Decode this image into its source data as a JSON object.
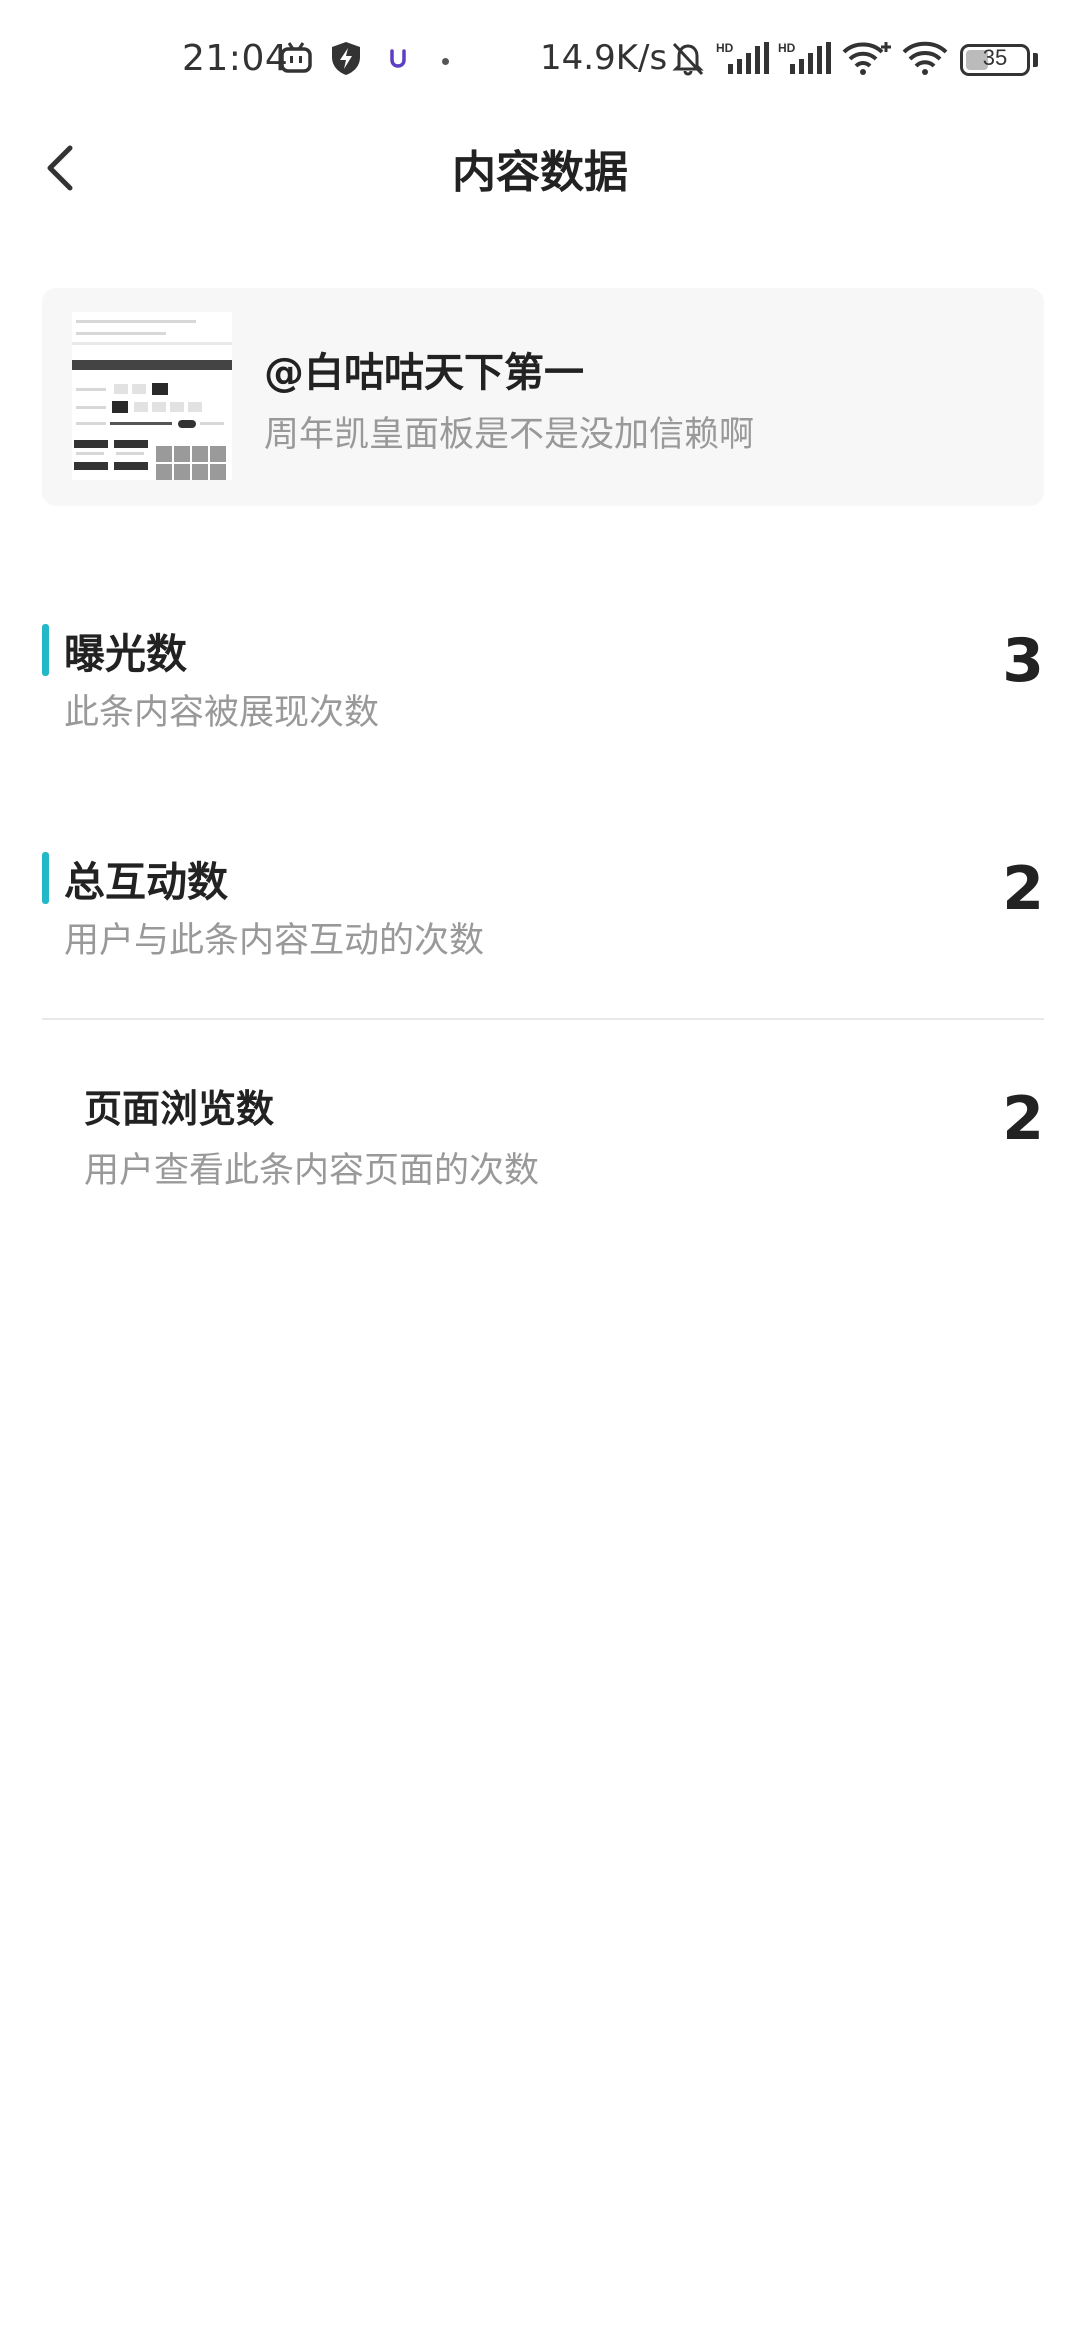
{
  "status_bar": {
    "time": "21:04",
    "net_speed": "14.9K/s",
    "battery": "35",
    "icons": [
      "tv-icon",
      "shield-bolt-icon",
      "app-u-icon",
      "dot-icon",
      "bell-off-icon",
      "hd-signal-icon",
      "hd-signal-icon",
      "wifi-plus-icon",
      "wifi-icon",
      "battery-icon"
    ]
  },
  "header": {
    "title": "内容数据",
    "back_icon": "chevron-left-icon"
  },
  "content_card": {
    "author": "@白咕咕天下第一",
    "description": "周年凯皇面板是不是没加信赖啊"
  },
  "metrics": [
    {
      "title": "曝光数",
      "description": "此条内容被展现次数",
      "value": "3"
    },
    {
      "title": "总互动数",
      "description": "用户与此条内容互动的次数",
      "value": "2"
    },
    {
      "title": "页面浏览数",
      "description": "用户查看此条内容页面的次数",
      "value": "2"
    }
  ],
  "colors": {
    "accent": "#22b8c8",
    "secondary_text": "#999999",
    "card_bg": "#f7f7f7"
  }
}
